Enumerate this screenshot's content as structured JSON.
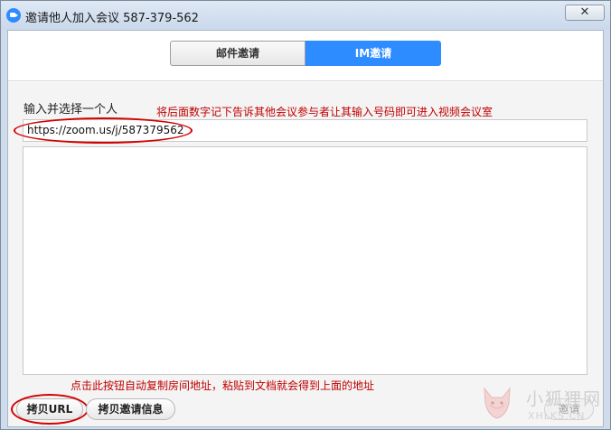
{
  "window": {
    "title": "邀请他人加入会议 587-379-562",
    "close_label": "✕"
  },
  "tabs": [
    {
      "label": "邮件邀请",
      "selected": false
    },
    {
      "label": "IM邀请",
      "selected": true
    }
  ],
  "form": {
    "prompt_label": "输入并选择一个人",
    "url_value": "https://zoom.us/j/587379562"
  },
  "annotations": {
    "top": "将后面数字记下告诉其他会议参与者让其输入号码即可进入视频会议室",
    "bottom": "点击此按钮自动复制房间地址，粘贴到文档就会得到上面的地址"
  },
  "buttons": {
    "copy_url": "拷贝URL",
    "copy_invite_info": "拷贝邀请信息",
    "invite": "邀请"
  },
  "watermark": {
    "text_cn": "小狐狸网",
    "text_en": "XHLKS.CN"
  },
  "colors": {
    "accent": "#2d8cff",
    "annotation": "#c00000"
  }
}
